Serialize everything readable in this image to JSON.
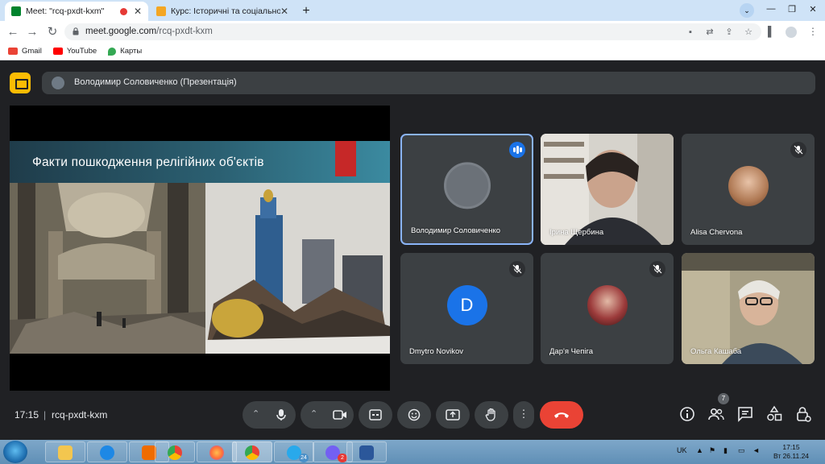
{
  "browser": {
    "tabs": [
      {
        "title": "Meet: \"rcq-pxdt-kxm\"",
        "active": true,
        "recording": true
      },
      {
        "title": "Курс: Історичні та соціально-по",
        "active": false
      }
    ],
    "new_tab": "+",
    "url_host": "meet.google.com",
    "url_path": "/rcq-pxdt-kxm",
    "bookmarks": [
      {
        "label": "Gmail",
        "color": "#ea4335"
      },
      {
        "label": "YouTube",
        "color": "#ff0000"
      },
      {
        "label": "Карты",
        "color": "#34a853"
      }
    ]
  },
  "meet": {
    "presenter_label": "Володимир Соловиченко (Презентація)",
    "slide_title": "Факти пошкодження релігійних об'єктів",
    "participants": [
      {
        "name": "Володимир Соловиченко",
        "speaking": true,
        "muted": false
      },
      {
        "name": "Ірина Щербина",
        "speaking": false,
        "muted": false
      },
      {
        "name": "Alisa Chervona",
        "speaking": false,
        "muted": true
      },
      {
        "name": "Dmytro Novikov",
        "speaking": false,
        "muted": true,
        "initial": "D"
      },
      {
        "name": "Дар'я Чепіга",
        "speaking": false,
        "muted": true
      },
      {
        "name": "Ольга Кашаба",
        "speaking": false,
        "muted": false
      }
    ],
    "time": "17:15",
    "separator": "|",
    "meeting_code": "rcq-pxdt-kxm",
    "participant_count": "7"
  },
  "taskbar": {
    "language": "UK",
    "clock_time": "17:15",
    "clock_date": "Вт 26.11.24",
    "telegram_badge": "24",
    "viber_badge": "2"
  },
  "colors": {
    "meet_bg": "#202124",
    "tile_bg": "#3c4043",
    "accent_blue": "#1a73e8",
    "end_call_red": "#ea4335",
    "present_yellow": "#fbbc04"
  }
}
